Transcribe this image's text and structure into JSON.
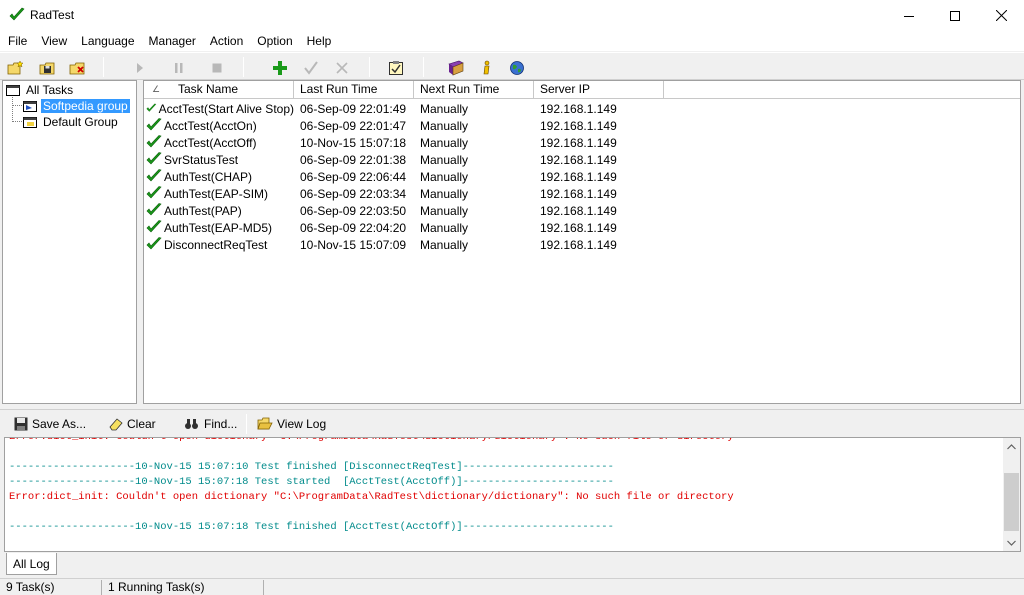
{
  "window": {
    "title": "RadTest",
    "icon": "radtest-check-icon",
    "controls": [
      "minimize-icon",
      "maximize-icon",
      "close-icon"
    ]
  },
  "menu": [
    "File",
    "View",
    "Language",
    "Manager",
    "Action",
    "Option",
    "Help"
  ],
  "toolbar": {
    "buttons": [
      {
        "icon": "new-group-icon",
        "enabled": true
      },
      {
        "icon": "save-group-icon",
        "enabled": true
      },
      {
        "icon": "delete-group-icon",
        "enabled": true
      },
      {
        "icon": "run-icon",
        "enabled": false
      },
      {
        "icon": "pause-icon",
        "enabled": false
      },
      {
        "icon": "stop-icon",
        "enabled": false
      },
      {
        "icon": "add-task-icon",
        "enabled": true
      },
      {
        "icon": "edit-task-icon",
        "enabled": false
      },
      {
        "icon": "delete-task-icon",
        "enabled": false
      },
      {
        "icon": "checklist-icon",
        "enabled": true
      },
      {
        "icon": "book-icon",
        "enabled": true
      },
      {
        "icon": "info-icon",
        "enabled": true
      },
      {
        "icon": "web-icon",
        "enabled": true
      }
    ]
  },
  "tree": {
    "root": "All Tasks",
    "groups": [
      {
        "label": "Softpedia group",
        "selected": true
      },
      {
        "label": "Default Group",
        "selected": false
      }
    ]
  },
  "task_list": {
    "columns": [
      "Task Name",
      "Last Run Time",
      "Next Run Time",
      "Server IP"
    ],
    "rows": [
      [
        "AcctTest(Start Alive Stop)",
        "06-Sep-09 22:01:49",
        "Manually",
        "192.168.1.149"
      ],
      [
        "AcctTest(AcctOn)",
        "06-Sep-09 22:01:47",
        "Manually",
        "192.168.1.149"
      ],
      [
        "AcctTest(AcctOff)",
        "10-Nov-15 15:07:18",
        "Manually",
        "192.168.1.149"
      ],
      [
        "SvrStatusTest",
        "06-Sep-09 22:01:38",
        "Manually",
        "192.168.1.149"
      ],
      [
        "AuthTest(CHAP)",
        "06-Sep-09 22:06:44",
        "Manually",
        "192.168.1.149"
      ],
      [
        "AuthTest(EAP-SIM)",
        "06-Sep-09 22:03:34",
        "Manually",
        "192.168.1.149"
      ],
      [
        "AuthTest(PAP)",
        "06-Sep-09 22:03:50",
        "Manually",
        "192.168.1.149"
      ],
      [
        "AuthTest(EAP-MD5)",
        "06-Sep-09 22:04:20",
        "Manually",
        "192.168.1.149"
      ],
      [
        "DisconnectReqTest",
        "10-Nov-15 15:07:09",
        "Manually",
        "192.168.1.149"
      ]
    ]
  },
  "log_toolbar": {
    "save_as": "Save As...",
    "clear": "Clear",
    "find": "Find...",
    "view_log": "View Log"
  },
  "log": {
    "lines": [
      {
        "text": "Error:dict_init: Couldn't open dictionary \"C:\\ProgramData\\RadTest\\dictionary/dictionary\": No such file or directory",
        "color": "red"
      },
      {
        "text": "",
        "color": "teal"
      },
      {
        "text": "--------------------10-Nov-15 15:07:10 Test finished [DisconnectReqTest]------------------------",
        "color": "teal"
      },
      {
        "text": "--------------------10-Nov-15 15:07:18 Test started  [AcctTest(AcctOff)]------------------------",
        "color": "teal"
      },
      {
        "text": "Error:dict_init: Couldn't open dictionary \"C:\\ProgramData\\RadTest\\dictionary/dictionary\": No such file or directory",
        "color": "red"
      },
      {
        "text": "",
        "color": "teal"
      },
      {
        "text": "--------------------10-Nov-15 15:07:18 Test finished [AcctTest(AcctOff)]------------------------",
        "color": "teal"
      }
    ],
    "tab": "All Log"
  },
  "status": {
    "tasks": "9 Task(s)",
    "running": "1 Running Task(s)"
  },
  "colors": {
    "selection": "#3399ff",
    "log_teal": "#008b8b",
    "log_red": "#e00000",
    "check_green": "#1a9a1a"
  }
}
